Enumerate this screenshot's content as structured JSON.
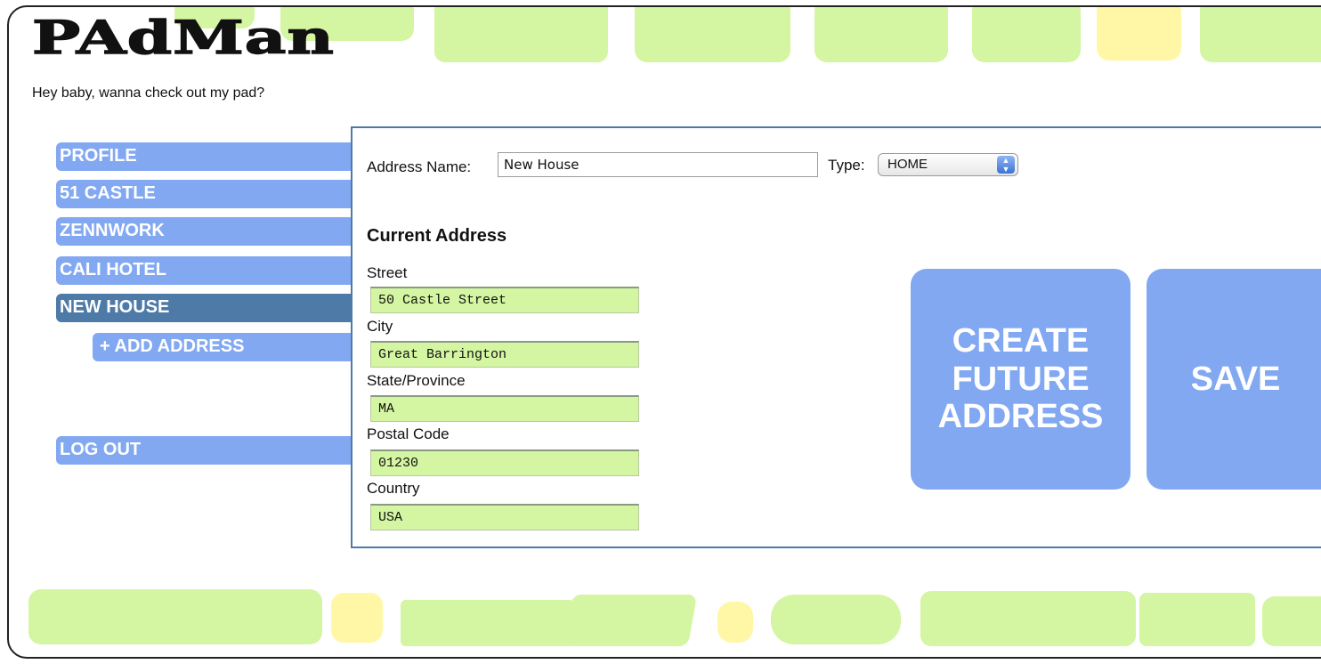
{
  "app": {
    "logo": "PAdMan",
    "tagline": "Hey baby, wanna check out my pad?"
  },
  "sidebar": {
    "items": [
      {
        "label": "PROFILE"
      },
      {
        "label": "51 CASTLE"
      },
      {
        "label": "ZENNWORK"
      },
      {
        "label": "CALI HOTEL"
      },
      {
        "label": "NEW HOUSE",
        "active": true
      }
    ],
    "add_address": "+ ADD ADDRESS",
    "logout": "LOG OUT"
  },
  "form": {
    "address_name_label": "Address Name:",
    "address_name_value": "New House",
    "type_label": "Type:",
    "type_value": "HOME",
    "section_title": "Current Address",
    "fields": [
      {
        "label": "Street",
        "value": "50 Castle Street"
      },
      {
        "label": "City",
        "value": "Great Barrington"
      },
      {
        "label": "State/Province",
        "value": "MA"
      },
      {
        "label": "Postal Code",
        "value": "01230"
      },
      {
        "label": "Country",
        "value": "USA"
      }
    ]
  },
  "actions": {
    "create_future_line1": "CREATE",
    "create_future_line2": "FUTURE",
    "create_future_line3": "ADDRESS",
    "save": "SAVE"
  },
  "colors": {
    "nav": "#82a8f2",
    "nav_active": "#4e7aa8",
    "field_bg": "#d4f5a2",
    "deco_green": "#d4f5a2",
    "deco_yellow": "#fff7a6"
  }
}
